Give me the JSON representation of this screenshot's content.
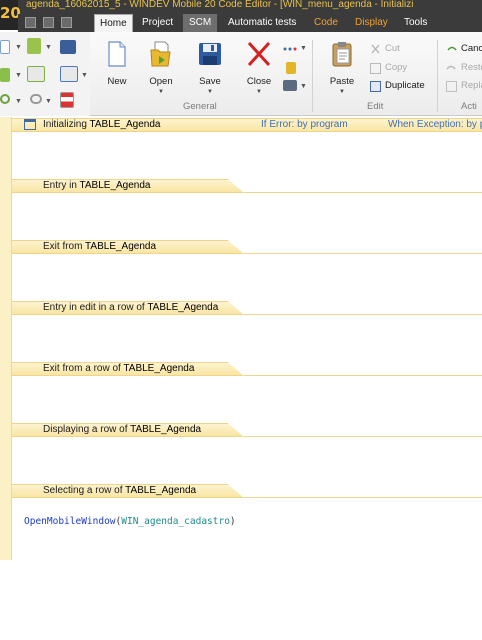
{
  "window": {
    "title": "agenda_16062015_5 - WINDEV Mobile 20 Code Editor - [WIN_menu_agenda - Initializi",
    "logo": "20"
  },
  "tabs": [
    {
      "label": "Home",
      "state": "active"
    },
    {
      "label": "Project",
      "state": "normal"
    },
    {
      "label": "SCM",
      "state": "highlight"
    },
    {
      "label": "Automatic tests",
      "state": "normal"
    },
    {
      "label": "Code",
      "state": "orange"
    },
    {
      "label": "Display",
      "state": "orange"
    },
    {
      "label": "Tools",
      "state": "normal"
    }
  ],
  "ribbon": {
    "general": {
      "label": "General",
      "buttons": [
        {
          "label": "New",
          "icon": "new-document-icon"
        },
        {
          "label": "Open",
          "icon": "open-folder-icon"
        },
        {
          "label": "Save",
          "icon": "save-floppy-icon"
        },
        {
          "label": "Close",
          "icon": "close-x-icon"
        }
      ]
    },
    "edit": {
      "label": "Edit",
      "paste": "Paste",
      "cut": "Cut",
      "copy": "Copy",
      "duplicate": "Duplicate"
    },
    "actions": {
      "label": "Acti",
      "cancel": "Canc",
      "restore": "Resto",
      "replace": "Repla"
    }
  },
  "editor": {
    "first_section": {
      "label_prefix": "Initializing ",
      "label_object": "TABLE_Agenda",
      "if_error": "If Error: by program",
      "when_exception": "When Exception: by p"
    },
    "sections": [
      {
        "prefix": "Entry in ",
        "object": "TABLE_Agenda"
      },
      {
        "prefix": "Exit from ",
        "object": "TABLE_Agenda"
      },
      {
        "prefix": "Entry in edit in a row of ",
        "object": "TABLE_Agenda"
      },
      {
        "prefix": "Exit from a row of ",
        "object": "TABLE_Agenda"
      },
      {
        "prefix": "Displaying a row of ",
        "object": "TABLE_Agenda"
      },
      {
        "prefix": "Selecting a row of ",
        "object": "TABLE_Agenda"
      }
    ],
    "code_line": {
      "function": "OpenMobileWindow",
      "open_paren": "(",
      "argument": "WIN_agenda_cadastro",
      "close_paren": ")"
    }
  },
  "colors": {
    "ribbon_bg": "#f3f3f3",
    "section_bg": "#f9e5a3",
    "code_function": "#1c3cc4",
    "code_argument": "#1f8a8a",
    "title_text": "#e8c24a"
  }
}
